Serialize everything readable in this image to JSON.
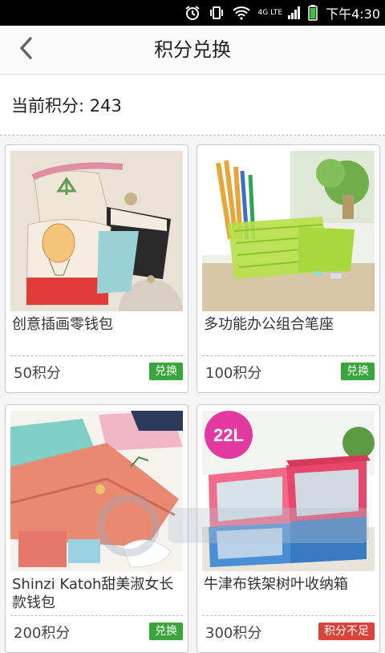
{
  "status_bar": {
    "network_label": "4G LTE",
    "time": "下午4:30"
  },
  "header": {
    "title": "积分兑换"
  },
  "points": {
    "text": "当前积分: 243"
  },
  "products": [
    {
      "name": "创意插画零钱包",
      "price": "50积分",
      "action": "兑换",
      "status": "available"
    },
    {
      "name": "多功能办公组合笔座",
      "price": "100积分",
      "action": "兑换",
      "status": "available"
    },
    {
      "name": "Shinzi Katoh甜美淑女长款钱包",
      "price": "200积分",
      "action": "兑换",
      "status": "available"
    },
    {
      "name": "牛津布铁架树叶收纳箱",
      "price": "300积分",
      "action": "积分不足",
      "status": "insufficient",
      "badge": "22L"
    }
  ],
  "colors": {
    "redeem_available": "#3aa53a",
    "redeem_insufficient": "#d9443a"
  },
  "icons": {
    "back": "back-arrow-icon",
    "alarm": "alarm-icon",
    "vibrate": "vibrate-icon",
    "wifi": "wifi-icon",
    "signal": "signal-icon",
    "battery": "battery-icon"
  }
}
